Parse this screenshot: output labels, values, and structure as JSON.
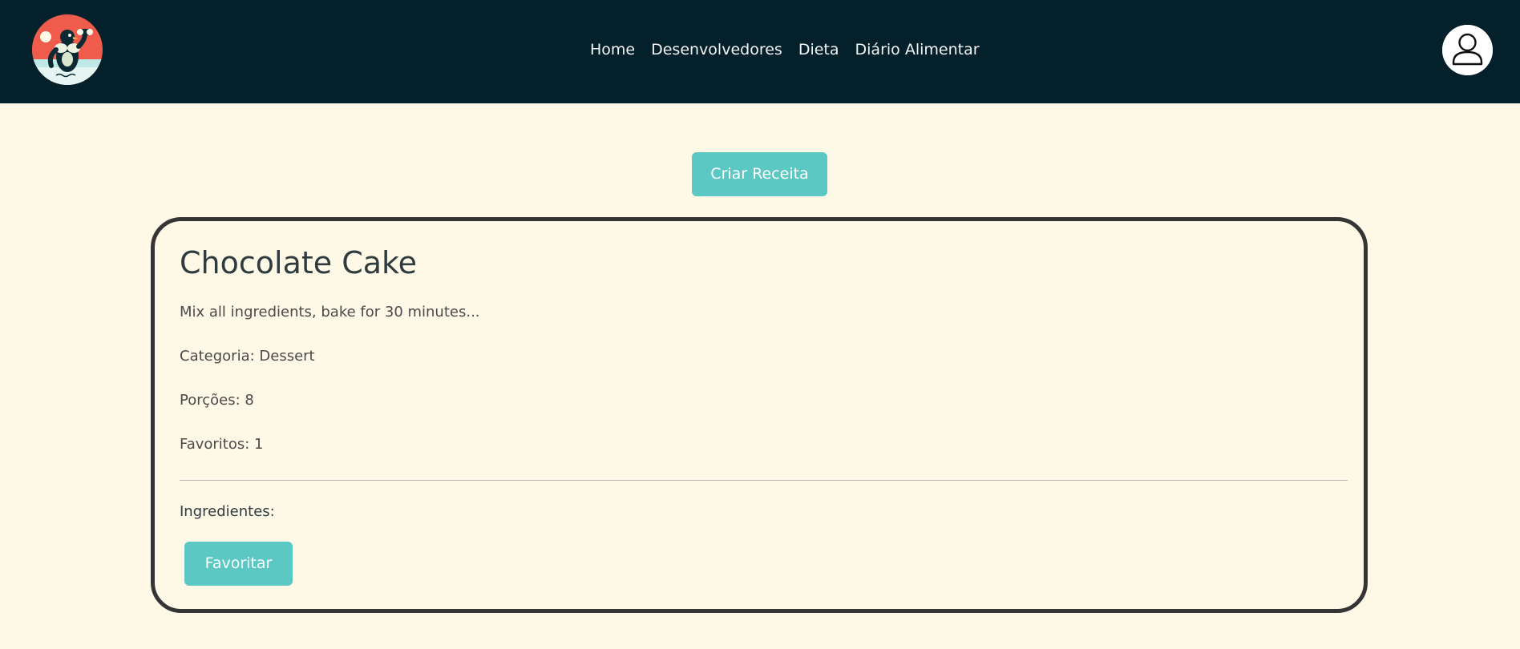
{
  "header": {
    "logo_icon": "bodybuilder-penguin-logo-icon",
    "nav": [
      {
        "label": "Home"
      },
      {
        "label": "Desenvolvedores"
      },
      {
        "label": "Dieta"
      },
      {
        "label": "Diário Alimentar"
      }
    ],
    "profile_icon": "user-icon"
  },
  "main": {
    "create_button_label": "Criar Receita",
    "recipe": {
      "title": "Chocolate Cake",
      "instructions": "Mix all ingredients, bake for 30 minutes...",
      "category": "Categoria: Dessert",
      "portions": "Porções: 8",
      "favorites": "Favoritos: 1",
      "ingredients_label": "Ingredientes:",
      "favorite_button_label": "Favoritar"
    }
  },
  "colors": {
    "navbar_bg": "#03202b",
    "page_bg": "#fef9e7",
    "accent": "#5bc8c3",
    "logo_bg": "#ef5c4c"
  }
}
